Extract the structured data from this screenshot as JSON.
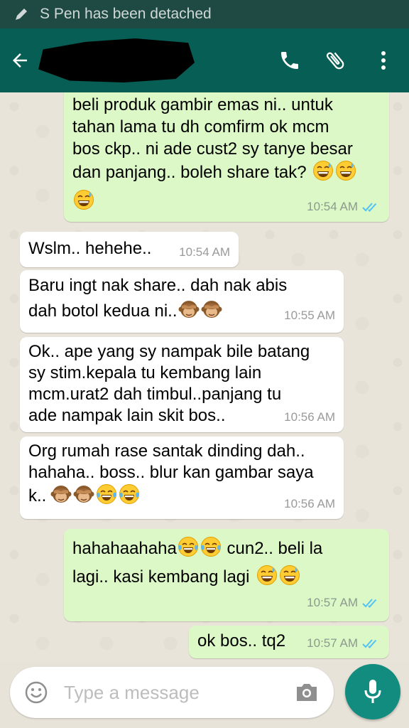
{
  "status_bar": {
    "notification": "S Pen has been detached",
    "icon": "pen-icon"
  },
  "app_bar": {
    "contact_name_redacted": true
  },
  "messages": [
    {
      "dir": "out",
      "text": "beli produk gambir emas ni.. untuk\ntahan lama tu dh comfirm ok mcm\nbos ckp.. ni ade cust2 sy tanye besar\ndan panjang.. boleh share tak?",
      "time": "10:54 AM",
      "emoji": [
        "sweat-smile",
        "sweat-smile",
        "sweat-smile"
      ]
    },
    {
      "dir": "in",
      "text": "Wslm.. hehehe..",
      "time": "10:54 AM"
    },
    {
      "dir": "in",
      "text": "Baru ingt nak share.. dah nak abis\ndah botol kedua ni..",
      "time": "10:55 AM",
      "emoji": [
        "see-no-evil-monkey",
        "see-no-evil-monkey"
      ]
    },
    {
      "dir": "in",
      "text": "Ok.. ape yang sy nampak bile batang\nsy stim.kepala tu kembang lain\nmcm.urat2 dah timbul..panjang tu\nade nampak lain skit bos..",
      "time": "10:56 AM"
    },
    {
      "dir": "in",
      "text": "Org rumah rase santak dinding dah..\nhahaha.. boss.. blur kan gambar saya\nk..",
      "time": "10:56 AM",
      "emoji": [
        "see-no-evil-monkey",
        "see-no-evil-monkey",
        "tears-of-joy",
        "tears-of-joy"
      ]
    },
    {
      "dir": "out",
      "text_a": "hahahaahaha",
      "text_b": " cun2.. beli la",
      "text_c": "lagi.. kasi kembang lagi",
      "time": "10:57 AM"
    },
    {
      "dir": "out",
      "text": "ok bos.. tq2",
      "time": "10:57 AM"
    }
  ],
  "input": {
    "placeholder": "Type a message"
  },
  "colors": {
    "header": "#075e54",
    "status": "#1f4a43",
    "outgoing": "#dcf8c6",
    "incoming": "#ffffff",
    "fab": "#128c7e",
    "read_tick": "#4fc3f7"
  }
}
